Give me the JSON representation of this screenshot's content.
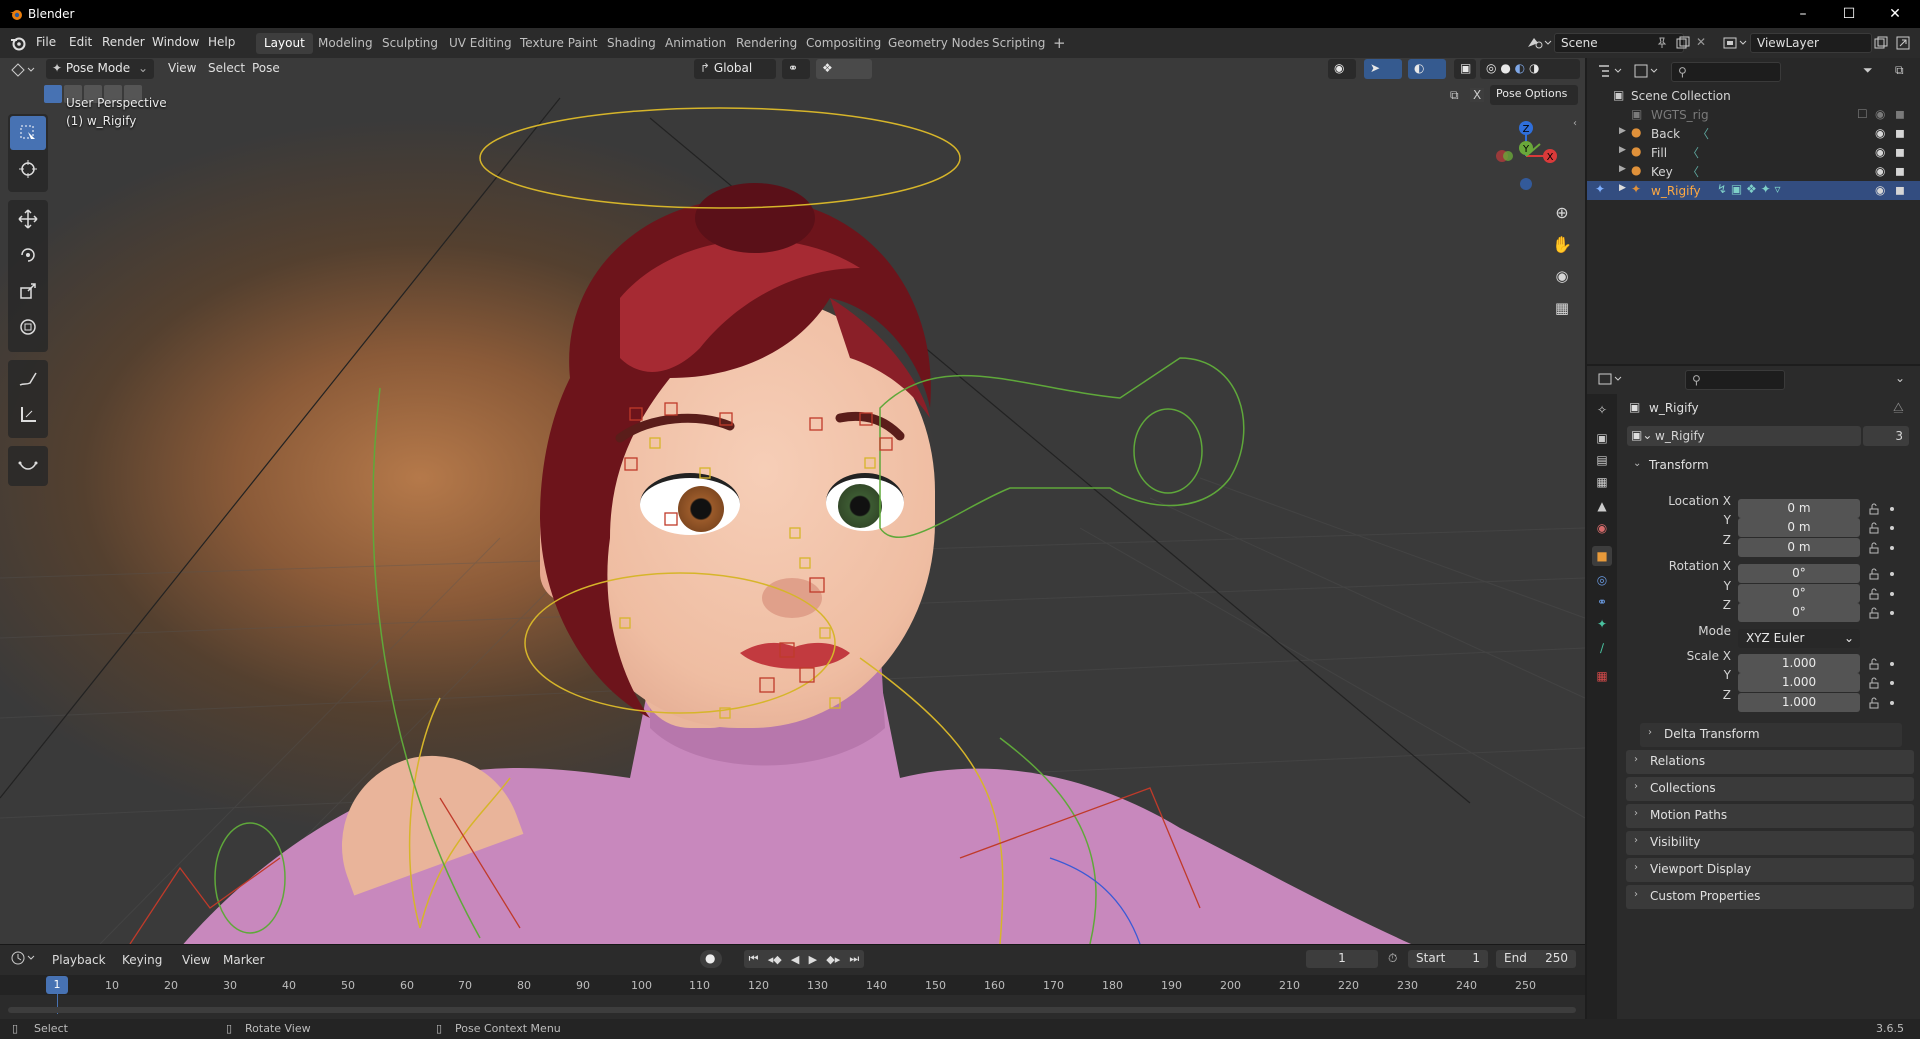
{
  "window": {
    "title": "Blender"
  },
  "menu": [
    "File",
    "Edit",
    "Render",
    "Window",
    "Help"
  ],
  "workspaces": [
    "Layout",
    "Modeling",
    "Sculpting",
    "UV Editing",
    "Texture Paint",
    "Shading",
    "Animation",
    "Rendering",
    "Compositing",
    "Geometry Nodes",
    "Scripting"
  ],
  "active_workspace": "Layout",
  "scene": "Scene",
  "view_layer": "ViewLayer",
  "viewport": {
    "mode": "Pose Mode",
    "menus": [
      "View",
      "Select",
      "Pose"
    ],
    "orientation": "Global",
    "pose_options": "Pose Options",
    "overlay_line1": "User Perspective",
    "overlay_line2": "(1) w_Rigify",
    "gizmo_axes": {
      "x": "X",
      "y": "Y",
      "z": "Z"
    }
  },
  "outliner": {
    "root": "Scene Collection",
    "items": [
      {
        "name": "WGTS_rig",
        "disabled": true
      },
      {
        "name": "Back"
      },
      {
        "name": "Fill"
      },
      {
        "name": "Key"
      },
      {
        "name": "w_Rigify",
        "selected": true
      }
    ]
  },
  "properties": {
    "object_name": "w_Rigify",
    "datablock_name": "w_Rigify",
    "user_count": "3",
    "transform_label": "Transform",
    "location": {
      "label_x": "Location X",
      "label_y": "Y",
      "label_z": "Z",
      "x": "0 m",
      "y": "0 m",
      "z": "0 m"
    },
    "rotation": {
      "label_x": "Rotation X",
      "label_y": "Y",
      "label_z": "Z",
      "x": "0°",
      "y": "0°",
      "z": "0°"
    },
    "mode_label": "Mode",
    "mode_value": "XYZ Euler",
    "scale": {
      "label_x": "Scale X",
      "label_y": "Y",
      "label_z": "Z",
      "x": "1.000",
      "y": "1.000",
      "z": "1.000"
    },
    "delta_transform": "Delta Transform",
    "panels": [
      "Relations",
      "Collections",
      "Motion Paths",
      "Visibility",
      "Viewport Display",
      "Custom Properties"
    ]
  },
  "timeline": {
    "menus": [
      "Playback",
      "Keying",
      "View",
      "Marker"
    ],
    "current_frame": "1",
    "start_label": "Start",
    "start": "1",
    "end_label": "End",
    "end": "250",
    "ticks": [
      "1",
      "10",
      "20",
      "30",
      "40",
      "50",
      "60",
      "70",
      "80",
      "90",
      "100",
      "110",
      "120",
      "130",
      "140",
      "150",
      "160",
      "170",
      "180",
      "190",
      "200",
      "210",
      "220",
      "230",
      "240",
      "250"
    ]
  },
  "statusbar": {
    "left": "Select",
    "middle": "Rotate View",
    "right": "Pose Context Menu",
    "version": "3.6.5"
  },
  "colors": {
    "accent": "#4772b3",
    "selected_row": "#334d80",
    "bone_yellow": "#d6b52a",
    "bone_green": "#5fa83a",
    "bone_red": "#c03a2a"
  }
}
